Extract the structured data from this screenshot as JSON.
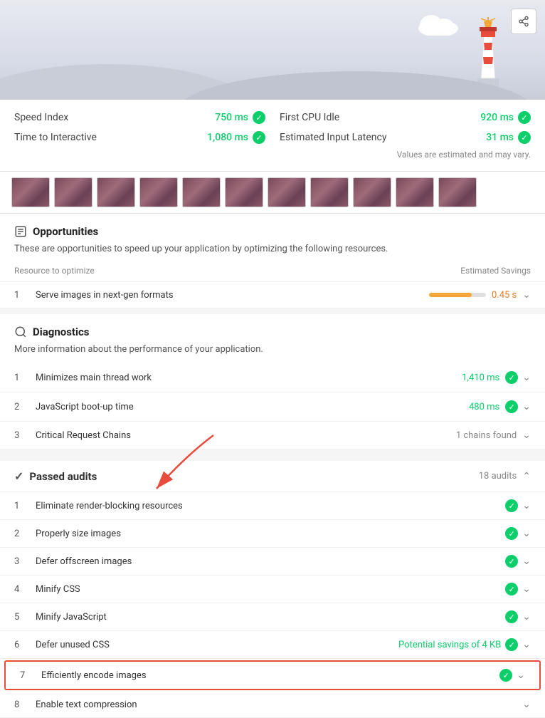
{
  "header": {
    "share_label": "Share"
  },
  "metrics": {
    "speed_index_label": "Speed Index",
    "speed_index_value": "750 ms",
    "first_cpu_idle_label": "First CPU Idle",
    "first_cpu_idle_value": "920 ms",
    "time_to_interactive_label": "Time to Interactive",
    "time_to_interactive_value": "1,080 ms",
    "estimated_input_latency_label": "Estimated Input Latency",
    "estimated_input_latency_value": "31 ms",
    "estimated_note": "Values are estimated and may vary."
  },
  "opportunities": {
    "section_title": "Opportunities",
    "section_desc": "These are opportunities to speed up your application by optimizing the following resources.",
    "table_col1": "Resource to optimize",
    "table_col2": "Estimated Savings",
    "items": [
      {
        "number": "1",
        "label": "Serve images in next-gen formats",
        "savings": "0.45 s",
        "bar_width": "75"
      }
    ]
  },
  "diagnostics": {
    "section_title": "Diagnostics",
    "section_desc": "More information about the performance of your application.",
    "items": [
      {
        "number": "1",
        "label": "Minimizes main thread work",
        "value": "1,410 ms",
        "value_type": "green"
      },
      {
        "number": "2",
        "label": "JavaScript boot-up time",
        "value": "480 ms",
        "value_type": "green"
      },
      {
        "number": "3",
        "label": "Critical Request Chains",
        "value": "1 chains found",
        "value_type": "gray"
      }
    ]
  },
  "passed_audits": {
    "title": "Passed audits",
    "count": "18 audits",
    "items": [
      {
        "number": "1",
        "label": "Eliminate render-blocking resources",
        "has_check": true,
        "highlighted": false
      },
      {
        "number": "2",
        "label": "Properly size images",
        "has_check": true,
        "highlighted": false
      },
      {
        "number": "3",
        "label": "Defer offscreen images",
        "has_check": true,
        "highlighted": false
      },
      {
        "number": "4",
        "label": "Minify CSS",
        "has_check": true,
        "highlighted": false
      },
      {
        "number": "5",
        "label": "Minify JavaScript",
        "has_check": true,
        "highlighted": false
      },
      {
        "number": "6",
        "label": "Defer unused CSS",
        "has_check": true,
        "highlighted": false,
        "savings_text": "Potential savings of 4 KB"
      },
      {
        "number": "7",
        "label": "Efficiently encode images",
        "has_check": true,
        "highlighted": true
      },
      {
        "number": "8",
        "label": "Enable text compression",
        "has_check": false,
        "highlighted": false
      }
    ]
  }
}
